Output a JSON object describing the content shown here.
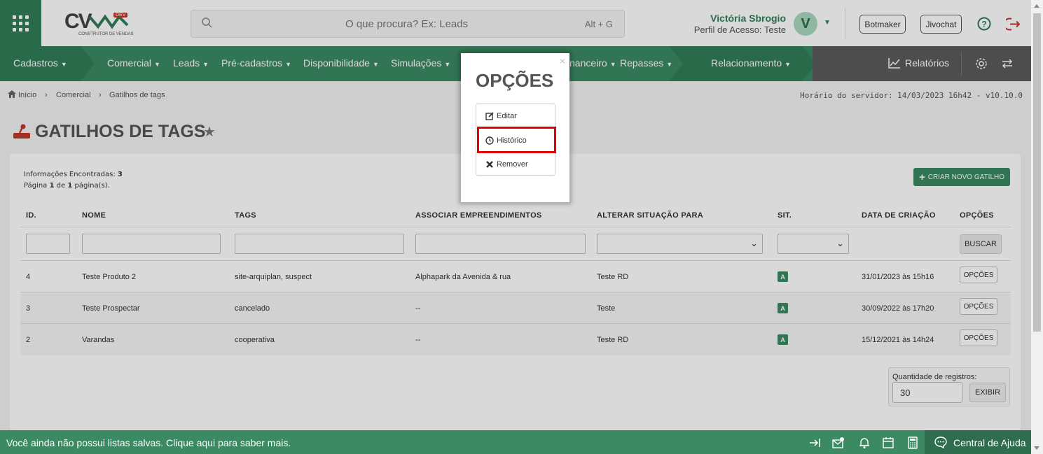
{
  "app": {
    "logo_text": "CV",
    "logo_badge": "DEV",
    "logo_sub": "CONSTRUTOR DE VENDAS"
  },
  "search": {
    "placeholder": "O que procura? Ex: Leads",
    "shortcut": "Alt + G"
  },
  "user": {
    "name": "Victória Sbrogio",
    "profile": "Perfil de Acesso: Teste",
    "initial": "V"
  },
  "top_buttons": {
    "botmaker": "Botmaker",
    "jivochat": "Jivochat"
  },
  "nav": {
    "items": [
      "Cadastros",
      "Comercial",
      "Leads",
      "Pré-cadastros",
      "Disponibilidade",
      "Simulações",
      "nanceiro",
      "Repasses",
      "Relacionamento"
    ],
    "relatorios": "Relatórios"
  },
  "breadcrumb": {
    "items": [
      "Início",
      "Comercial",
      "Gatilhos de tags"
    ],
    "server_time": "Horário do servidor: 14/03/2023 16h42 - v10.10.0"
  },
  "page": {
    "title": "GATILHOS DE TAGS"
  },
  "info": {
    "found_label": "Informações Encontradas:",
    "found_count": "3",
    "page_prefix": "Página",
    "page_current": "1",
    "page_of": "de",
    "page_total": "1",
    "page_suffix": "página(s)."
  },
  "new_button": "CRIAR NOVO GATILHO",
  "table": {
    "headers": [
      "ID.",
      "NOME",
      "TAGS",
      "ASSOCIAR EMPREENDIMENTOS",
      "ALTERAR SITUAÇÃO PARA",
      "SIT.",
      "DATA DE CRIAÇÃO",
      "OPÇÕES"
    ],
    "search_button": "BUSCAR",
    "rows": [
      {
        "id": "4",
        "nome": "Teste Produto 2",
        "tags": "site-arquiplan, suspect",
        "emp": "Alphapark da Avenida & rua",
        "situacao": "Teste RD",
        "sit": "A",
        "data": "31/01/2023 às 15h16",
        "opcoes": "OPÇÕES"
      },
      {
        "id": "3",
        "nome": "Teste Prospectar",
        "tags": "cancelado",
        "emp": "--",
        "situacao": "Teste",
        "sit": "A",
        "data": "30/09/2022 às 17h20",
        "opcoes": "OPÇÕES"
      },
      {
        "id": "2",
        "nome": "Varandas",
        "tags": "cooperativa",
        "emp": "--",
        "situacao": "Teste RD",
        "sit": "A",
        "data": "15/12/2021 às 14h24",
        "opcoes": "OPÇÕES"
      }
    ]
  },
  "pagination": {
    "qty_label": "Quantidade de registros:",
    "qty_value": "30",
    "exibir": "EXIBIR"
  },
  "modal": {
    "title": "OPÇÕES",
    "close": "×",
    "items": [
      "Editar",
      "Histórico",
      "Remover"
    ]
  },
  "footer": {
    "text": "Você ainda não possui listas salvas. Clique aqui para saber mais.",
    "help_center": "Central de Ajuda"
  },
  "colors": {
    "brand_green": "#3b8a63",
    "dark_green": "#2f7d57",
    "highlight_red": "#e00000"
  }
}
